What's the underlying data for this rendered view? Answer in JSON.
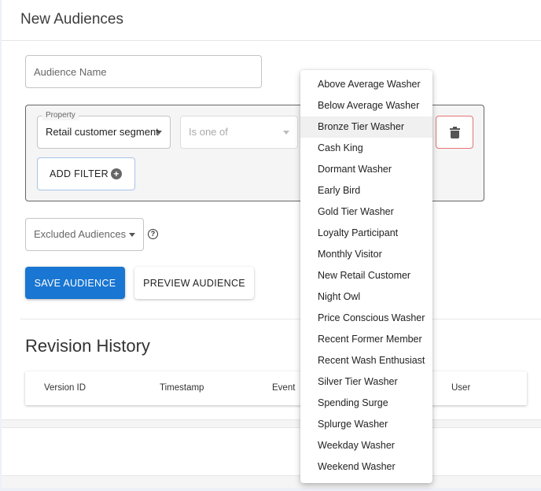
{
  "header": {
    "title": "New Audiences"
  },
  "form": {
    "audience_name_placeholder": "Audience Name",
    "filter": {
      "property_label": "Property",
      "property_value": "Retail customer segment",
      "operator_placeholder": "Is one of",
      "add_filter_label": "ADD FILTER"
    },
    "excluded_audiences_placeholder": "Excluded Audiences",
    "save_label": "SAVE AUDIENCE",
    "preview_label": "PREVIEW AUDIENCE"
  },
  "revision_history": {
    "title": "Revision History",
    "columns": [
      "Version ID",
      "Timestamp",
      "Event",
      "User"
    ]
  },
  "dropdown": {
    "highlighted_index": 2,
    "options": [
      "Above Average Washer",
      "Below Average Washer",
      "Bronze Tier Washer",
      "Cash King",
      "Dormant Washer",
      "Early Bird",
      "Gold Tier Washer",
      "Loyalty Participant",
      "Monthly Visitor",
      "New Retail Customer",
      "Night Owl",
      "Price Conscious Washer",
      "Recent Former Member",
      "Recent Wash Enthusiast",
      "Silver Tier Washer",
      "Spending Surge",
      "Splurge Washer",
      "Weekday Washer",
      "Weekend Washer"
    ]
  },
  "icons": {
    "select_caret": "chevron-down-icon",
    "delete": "trash-icon",
    "add": "plus-circle-icon",
    "help": "question-circle-icon"
  },
  "colors": {
    "primary": "#1976d2",
    "delete_border": "#e57373",
    "hover_item": "#f0f0f0"
  }
}
